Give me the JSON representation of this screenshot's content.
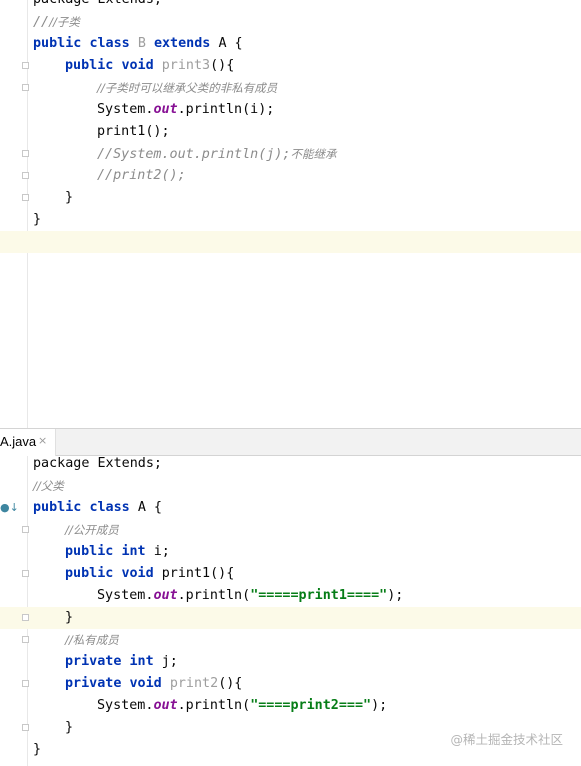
{
  "editor_top": {
    "lines": [
      {
        "text": "package Extends;"
      },
      {
        "text": "//子类"
      },
      {
        "kw1": "public",
        "kw2": "class",
        "name": "B",
        "kw3": "extends",
        "rest": "A {"
      },
      {
        "kw1": "public",
        "kw2": "void",
        "name": "print3",
        "rest": "(){"
      },
      {
        "comment": "//子类时可以继承父类的非私有成员"
      },
      {
        "pre": "System.",
        "field": "out",
        "post": ".println(i);"
      },
      {
        "text": "print1();"
      },
      {
        "comment": "//System.out.println(j);",
        "comment_cjk": "不能继承"
      },
      {
        "comment": "//print2();"
      },
      {
        "text": "}"
      },
      {
        "text": "}"
      }
    ]
  },
  "tab": {
    "label": "A.java",
    "close": "×"
  },
  "editor_bottom": {
    "gutter_icon": "implemented-by-icon",
    "lines": [
      {
        "kw": "package",
        "rest": "Extends;"
      },
      {
        "comment": "//父类"
      },
      {
        "kw1": "public",
        "kw2": "class",
        "rest": "A {"
      },
      {
        "comment": "//公开成员"
      },
      {
        "kw1": "public",
        "kw2": "int",
        "rest": "i;"
      },
      {
        "kw1": "public",
        "kw2": "void",
        "rest": "print1(){"
      },
      {
        "pre": "System.",
        "field": "out",
        "mid": ".println(",
        "str": "\"=====print1====\"",
        "post": ");"
      },
      {
        "text": "}"
      },
      {
        "comment": "//私有成员"
      },
      {
        "kw1": "private",
        "kw2": "int",
        "rest": "j;"
      },
      {
        "kw1": "private",
        "kw2": "void",
        "name": "print2",
        "rest": "(){"
      },
      {
        "pre": "System.",
        "field": "out",
        "mid": ".println(",
        "str": "\"====print2===\"",
        "post": ");"
      },
      {
        "text": "}"
      },
      {
        "text": "}"
      }
    ]
  },
  "watermark": "@稀土掘金技术社区",
  "colors": {
    "keyword": "#0033b3",
    "comment": "#8c8c8c",
    "field": "#871094",
    "string": "#067d17",
    "current_line": "#fcfae8"
  }
}
